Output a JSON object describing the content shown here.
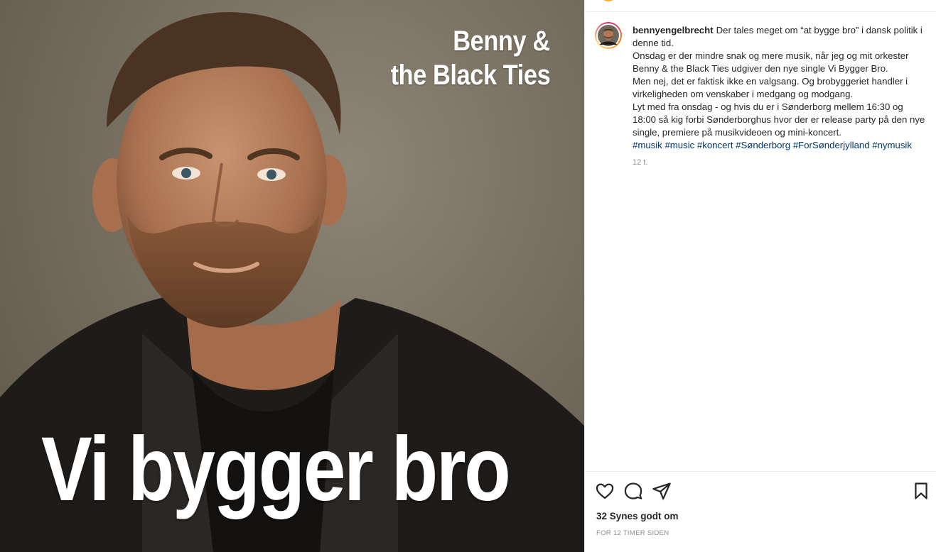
{
  "post_image": {
    "band_line_1": "Benny &",
    "band_line_2": "the Black Ties",
    "song_title": "Vi bygger bro"
  },
  "post": {
    "username": "bennyengelbrecht",
    "caption_paragraphs": [
      "Der tales meget om “at bygge bro” i dansk politik i denne tid.",
      "Onsdag er der mindre snak og mere musik, når jeg og mit orkester Benny & the Black Ties udgiver den nye single Vi Bygger Bro.",
      "Men nej, det er faktisk ikke en valgsang. Og brobyggeriet handler i virkeligheden om venskaber i medgang og modgang.",
      "Lyt med fra onsdag - og hvis du er i Sønderborg mellem 16:30 og 18:00 så kig forbi Sønderborghus hvor der er release party på den nye single, premiere på musikvideoen og mini-koncert."
    ],
    "hashtags": [
      "#musik",
      "#music",
      "#koncert",
      "#Sønderborg",
      "#ForSønderjylland",
      "#nymusik"
    ],
    "caption_age": "12 t.",
    "likes": "32 Synes godt om",
    "timestamp": "FOR 12 TIMER SIDEN"
  },
  "icons": {
    "like": "heart-icon",
    "comment": "comment-icon",
    "share": "paper-plane-icon",
    "save": "bookmark-icon"
  },
  "colors": {
    "hashtag": "#00376b",
    "muted": "#8e8e8e",
    "text": "#262626"
  }
}
